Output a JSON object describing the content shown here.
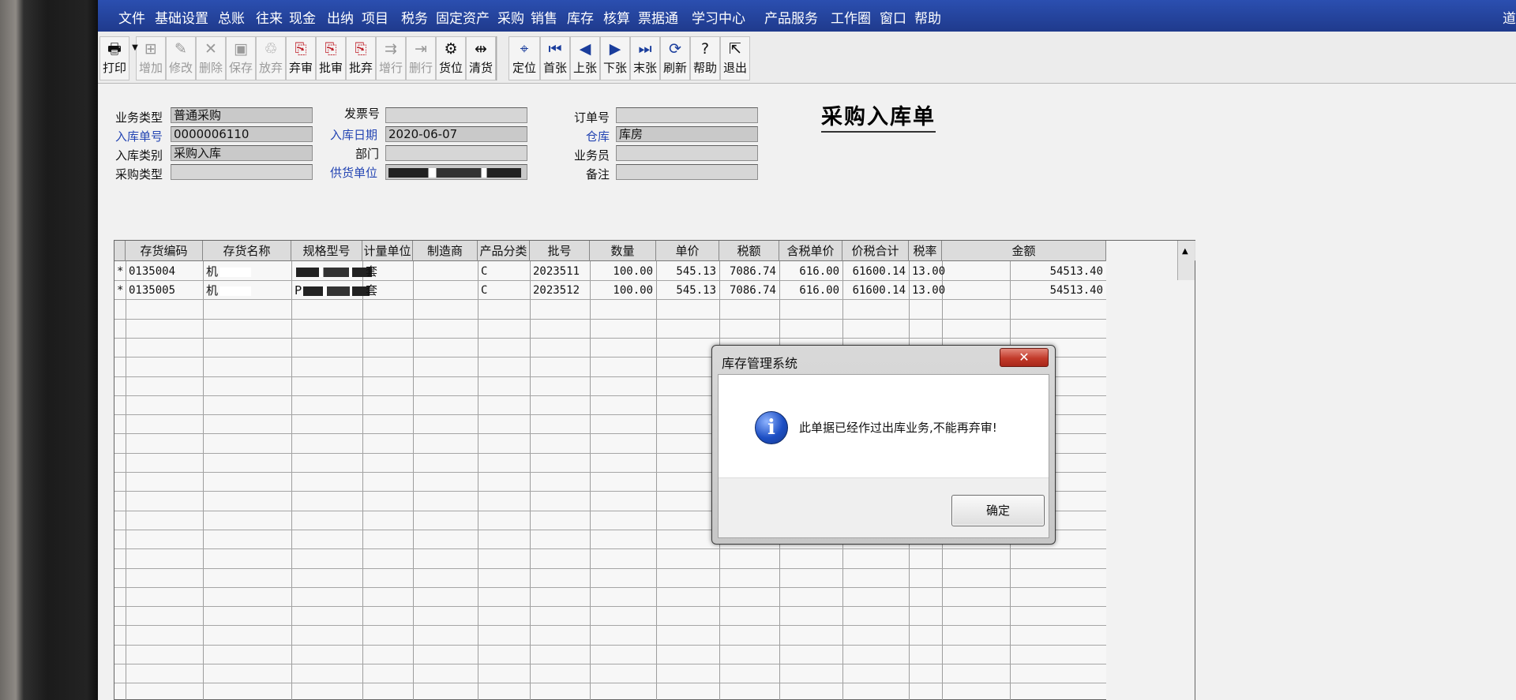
{
  "menu": {
    "items": [
      "文件",
      "基础设置",
      "总账",
      "往来",
      "现金",
      "出纳",
      "项目",
      "税务",
      "固定资产",
      "采购",
      "销售",
      "库存",
      "核算",
      "票据通",
      "学习中心",
      "产品服务",
      "工作圈",
      "窗口",
      "帮助"
    ],
    "right_text": "道"
  },
  "toolbar": {
    "buttons": [
      {
        "label": "打印",
        "icon": "printer-icon",
        "glyph": "🖶",
        "enabled": true
      },
      {
        "label": "增加",
        "icon": "add-icon",
        "glyph": "⊞",
        "enabled": false
      },
      {
        "label": "修改",
        "icon": "edit-icon",
        "glyph": "✎",
        "enabled": false
      },
      {
        "label": "删除",
        "icon": "delete-icon",
        "glyph": "✕",
        "enabled": false
      },
      {
        "label": "保存",
        "icon": "save-icon",
        "glyph": "▣",
        "enabled": false
      },
      {
        "label": "放弃",
        "icon": "trash-icon",
        "glyph": "♲",
        "enabled": false
      },
      {
        "label": "弃审",
        "icon": "unapprove-icon",
        "glyph": "⎘",
        "enabled": true
      },
      {
        "label": "批审",
        "icon": "batch-approve-icon",
        "glyph": "⎘",
        "enabled": true
      },
      {
        "label": "批弃",
        "icon": "batch-unapprove-icon",
        "glyph": "⎘",
        "enabled": true
      },
      {
        "label": "增行",
        "icon": "add-row-icon",
        "glyph": "⇉",
        "enabled": false
      },
      {
        "label": "删行",
        "icon": "delete-row-icon",
        "glyph": "⇥",
        "enabled": false
      },
      {
        "label": "货位",
        "icon": "location-icon",
        "glyph": "⚙",
        "enabled": true
      },
      {
        "label": "清货",
        "icon": "clear-goods-icon",
        "glyph": "⇹",
        "enabled": true
      },
      {
        "label": "定位",
        "icon": "locate-icon",
        "glyph": "⌖",
        "enabled": true
      },
      {
        "label": "首张",
        "icon": "first-icon",
        "glyph": "⏮",
        "enabled": true
      },
      {
        "label": "上张",
        "icon": "previous-icon",
        "glyph": "◀",
        "enabled": true
      },
      {
        "label": "下张",
        "icon": "next-icon",
        "glyph": "▶",
        "enabled": true
      },
      {
        "label": "末张",
        "icon": "last-icon",
        "glyph": "⏭",
        "enabled": true
      },
      {
        "label": "刷新",
        "icon": "refresh-icon",
        "glyph": "⟳",
        "enabled": true
      },
      {
        "label": "帮助",
        "icon": "help-icon",
        "glyph": "?",
        "enabled": true
      },
      {
        "label": "退出",
        "icon": "exit-icon",
        "glyph": "⇱",
        "enabled": true
      }
    ]
  },
  "form": {
    "title": "采购入库单",
    "fields": {
      "business_type": {
        "label": "业务类型",
        "value": "普通采购"
      },
      "receipt_no": {
        "label": "入库单号",
        "value": "0000006110"
      },
      "receipt_category": {
        "label": "入库类别",
        "value": "采购入库"
      },
      "purchase_type": {
        "label": "采购类型",
        "value": ""
      },
      "invoice_no": {
        "label": "发票号",
        "value": ""
      },
      "receipt_date": {
        "label": "入库日期",
        "value": "2020-06-07"
      },
      "department": {
        "label": "部门",
        "value": ""
      },
      "supplier": {
        "label": "供货单位",
        "value": ""
      },
      "order_no": {
        "label": "订单号",
        "value": ""
      },
      "warehouse": {
        "label": "仓库",
        "value": "库房"
      },
      "salesperson": {
        "label": "业务员",
        "value": ""
      },
      "remark": {
        "label": "备注",
        "value": ""
      }
    }
  },
  "grid": {
    "columns": [
      "存货编码",
      "存货名称",
      "规格型号",
      "计量单位",
      "制造商",
      "产品分类",
      "批号",
      "数量",
      "单价",
      "税额",
      "含税单价",
      "价税合计",
      "税率",
      "金额"
    ],
    "rows": [
      {
        "marker": "*",
        "code": "0135004",
        "name": "机",
        "spec": "",
        "unit": "套",
        "maker": "",
        "category": "C",
        "batch": "2023511",
        "qty": "100.00",
        "price": "545.13",
        "tax": "7086.74",
        "tax_price": "616.00",
        "total": "61600.14",
        "rate": "13.00",
        "amount": "54513.40"
      },
      {
        "marker": "*",
        "code": "0135005",
        "name": "机",
        "spec": "P",
        "unit": "套",
        "maker": "",
        "category": "C",
        "batch": "2023512",
        "qty": "100.00",
        "price": "545.13",
        "tax": "7086.74",
        "tax_price": "616.00",
        "total": "61600.14",
        "rate": "13.00",
        "amount": "54513.40"
      }
    ]
  },
  "dialog": {
    "title": "库存管理系统",
    "message": "此单据已经作过出库业务,不能再弃审!",
    "ok_label": "确定",
    "close_label": "✕"
  }
}
